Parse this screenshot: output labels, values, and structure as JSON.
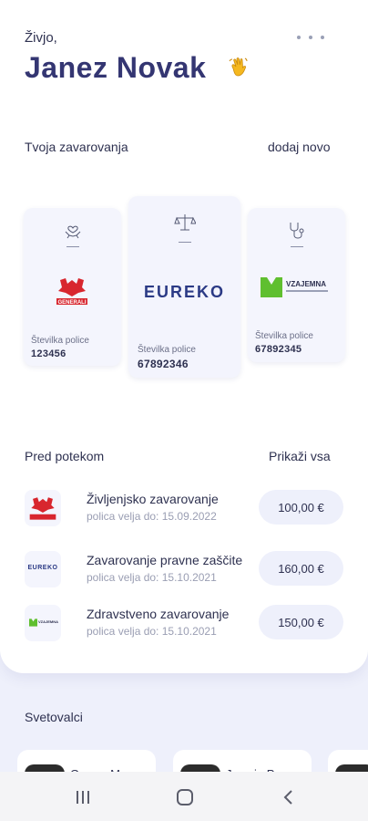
{
  "header": {
    "greeting": "Živjo,",
    "name": "Janez Novak",
    "wave_icon": "waving-hand-icon",
    "more_icon": "more-horizontal-icon"
  },
  "insurances": {
    "title": "Tvoja zavarovanja",
    "add_label": "dodaj novo",
    "cards": [
      {
        "category_icon": "hands-heart-icon",
        "insurer": "GENERALI",
        "number_label": "Številka police",
        "number": "123456"
      },
      {
        "category_icon": "scales-justice-icon",
        "insurer": "EUREKO",
        "number_label": "Številka police",
        "number": "67892346"
      },
      {
        "category_icon": "stethoscope-icon",
        "insurer": "VZAJEMNA",
        "number_label": "Številka police",
        "number": "67892345"
      }
    ]
  },
  "expiring": {
    "title": "Pred potekom",
    "show_all": "Prikaži vsa",
    "items": [
      {
        "logo": "GENERALI",
        "name": "Življenjsko zavarovanje",
        "valid": "polica velja do: 15.09.2022",
        "price": "100,00 €"
      },
      {
        "logo": "EUREKO",
        "name": "Zavarovanje pravne zaščite",
        "valid": "polica velja do: 15.10.2021",
        "price": "160,00 €"
      },
      {
        "logo": "VZAJEMNA",
        "name": "Zdravstveno zavarovanje",
        "valid": "polica velja do: 15.10.2021",
        "price": "150,00 €"
      }
    ]
  },
  "advisors": {
    "title": "Svetovalci",
    "items": [
      {
        "name": "Gregor M."
      },
      {
        "name": "Jasmin P."
      }
    ]
  },
  "colors": {
    "accent": "#343672",
    "background": "#eef0fb",
    "generali_red": "#d8262e",
    "vzajemna_green": "#5fbf2f"
  },
  "navbar": {
    "recents_icon": "recents-icon",
    "home_icon": "home-icon",
    "back_icon": "back-icon"
  }
}
